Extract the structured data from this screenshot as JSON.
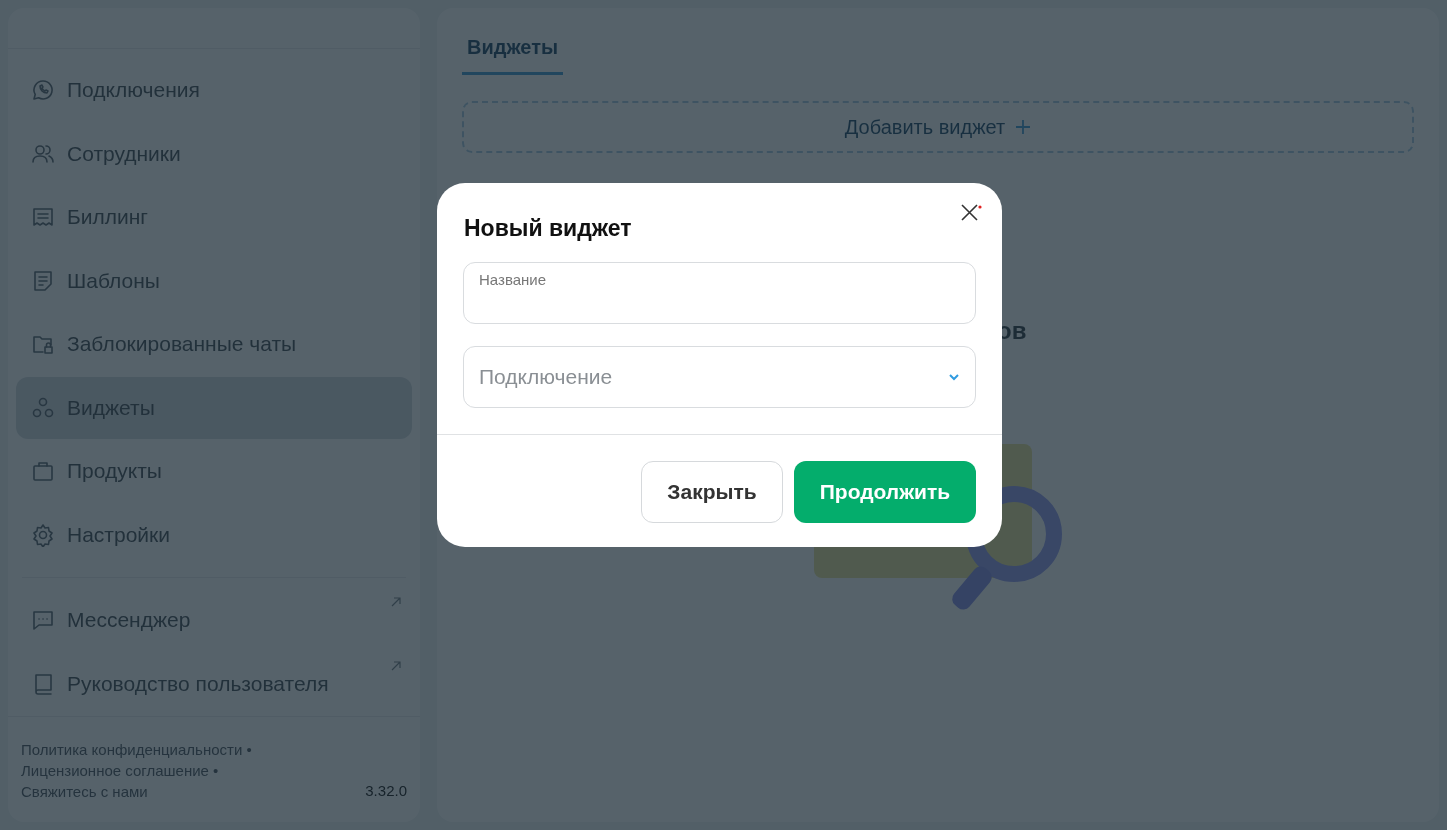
{
  "sidebar": {
    "nav_items": [
      {
        "label": "Подключения",
        "selected": false
      },
      {
        "label": "Сотрудники",
        "selected": false
      },
      {
        "label": "Биллинг",
        "selected": false
      },
      {
        "label": "Шаблоны",
        "selected": false
      },
      {
        "label": "Заблокированные чаты",
        "selected": false
      },
      {
        "label": "Виджеты",
        "selected": true
      },
      {
        "label": "Продукты",
        "selected": false
      },
      {
        "label": "Настройки",
        "selected": false
      }
    ],
    "external_links": [
      {
        "label": "Мессенджер"
      },
      {
        "label": "Руководство пользователя"
      }
    ],
    "footer": {
      "links": [
        "Политика конфиденциальности •",
        "Лицензионное соглашение •",
        "Свяжитесь с нами"
      ],
      "version": "3.32.0"
    }
  },
  "main": {
    "tabs": [
      {
        "label": "Виджеты",
        "selected": true
      }
    ],
    "add_button": "Добавить виджет",
    "hidden_text_fragment": "ов"
  },
  "modal": {
    "title": "Новый виджет",
    "name_field": {
      "label": "Название"
    },
    "connection_select": {
      "placeholder": "Подключение"
    },
    "buttons": [
      {
        "kind": "secondary",
        "label": "Закрыть"
      },
      {
        "kind": "primary",
        "label": "Продолжить"
      }
    ]
  }
}
